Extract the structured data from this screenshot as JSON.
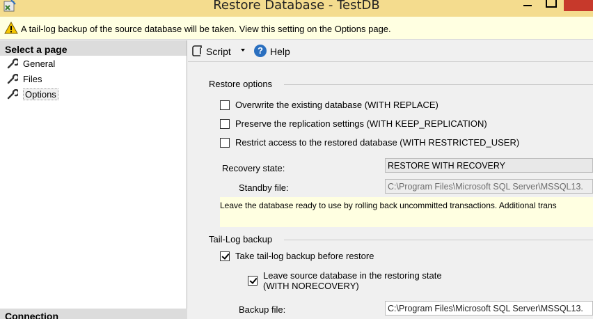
{
  "window": {
    "title": "Restore Database - TestDB",
    "close_color": "#c7392b",
    "titlebar_color": "#f4dc8e"
  },
  "warning": {
    "icon": "warning-icon",
    "text": "A tail-log backup of the source database will be taken. View this setting on the Options page."
  },
  "sidebar": {
    "header": "Select a page",
    "items": [
      {
        "label": "General",
        "icon": "wrench-icon",
        "selected": false
      },
      {
        "label": "Files",
        "icon": "wrench-icon",
        "selected": false
      },
      {
        "label": "Options",
        "icon": "wrench-icon",
        "selected": true
      }
    ],
    "footer": "Connection"
  },
  "toolbar": {
    "script_label": "Script",
    "help_label": "Help",
    "help_icon": "?"
  },
  "restore_options": {
    "title": "Restore options",
    "checkboxes": [
      {
        "label": "Overwrite the existing database (WITH REPLACE)",
        "checked": false
      },
      {
        "label": "Preserve the replication settings (WITH KEEP_REPLICATION)",
        "checked": false
      },
      {
        "label": "Restrict access to the restored database (WITH RESTRICTED_USER)",
        "checked": false
      }
    ],
    "recovery_state_label": "Recovery state:",
    "recovery_state_value": "RESTORE WITH RECOVERY",
    "standby_file_label": "Standby file:",
    "standby_file_value": "C:\\Program Files\\Microsoft SQL Server\\MSSQL13.",
    "description": "Leave the database ready to use by rolling back uncommitted transactions. Additional trans"
  },
  "tail_log": {
    "title": "Tail-Log backup",
    "take_backup_label": "Take tail-log backup before restore",
    "take_backup_checked": true,
    "leave_restoring_label_line1": "Leave source database in the restoring state",
    "leave_restoring_label_line2": "(WITH NORECOVERY)",
    "leave_restoring_checked": true,
    "backup_file_label": "Backup file:",
    "backup_file_value": "C:\\Program Files\\Microsoft SQL Server\\MSSQL13."
  }
}
